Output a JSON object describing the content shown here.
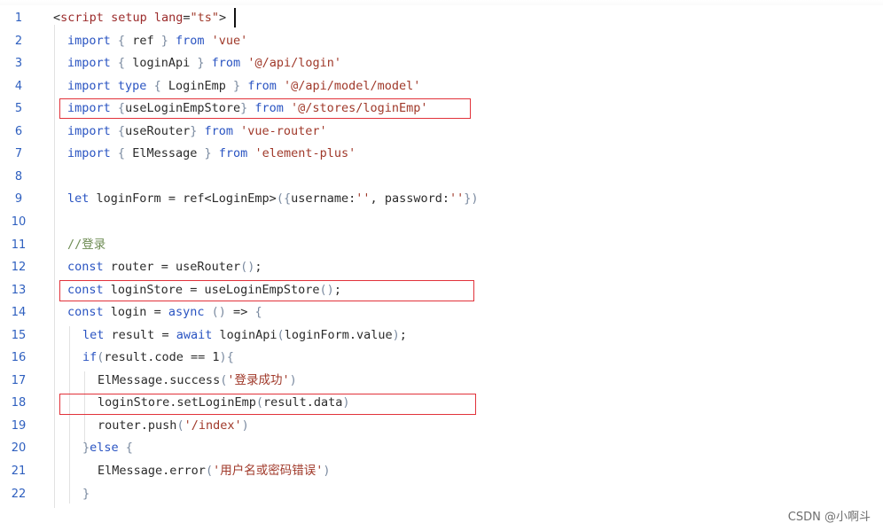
{
  "editor": {
    "lines": [
      {
        "num": "1",
        "text": "<script setup lang=\"ts\">"
      },
      {
        "num": "2",
        "text": "import { ref } from 'vue'"
      },
      {
        "num": "3",
        "text": "import { loginApi } from '@/api/login'"
      },
      {
        "num": "4",
        "text": "import type { LoginEmp } from '@/api/model/model'"
      },
      {
        "num": "5",
        "text": "import {useLoginEmpStore} from '@/stores/loginEmp'"
      },
      {
        "num": "6",
        "text": "import {useRouter} from 'vue-router'"
      },
      {
        "num": "7",
        "text": "import { ElMessage } from 'element-plus'"
      },
      {
        "num": "8",
        "text": ""
      },
      {
        "num": "9",
        "text": "let loginForm = ref<LoginEmp>({username:'', password:''})"
      },
      {
        "num": "10",
        "text": ""
      },
      {
        "num": "11",
        "text": "//登录"
      },
      {
        "num": "12",
        "text": "const router = useRouter();"
      },
      {
        "num": "13",
        "text": "const loginStore = useLoginEmpStore();"
      },
      {
        "num": "14",
        "text": "const login = async () => {"
      },
      {
        "num": "15",
        "text": "let result = await loginApi(loginForm.value);"
      },
      {
        "num": "16",
        "text": "if(result.code == 1){"
      },
      {
        "num": "17",
        "text": "ElMessage.success('登录成功')"
      },
      {
        "num": "18",
        "text": "loginStore.setLoginEmp(result.data)"
      },
      {
        "num": "19",
        "text": "router.push('/index')"
      },
      {
        "num": "20",
        "text": "}else {"
      },
      {
        "num": "21",
        "text": "ElMessage.error('用户名或密码错误')"
      },
      {
        "num": "22",
        "text": "}"
      }
    ]
  },
  "watermark": "CSDN @小啊斗",
  "colors": {
    "highlight_box": "#e1323a",
    "keyword": "#2a54c2",
    "string": "#a0392a",
    "line_number": "#2e5fbf"
  }
}
